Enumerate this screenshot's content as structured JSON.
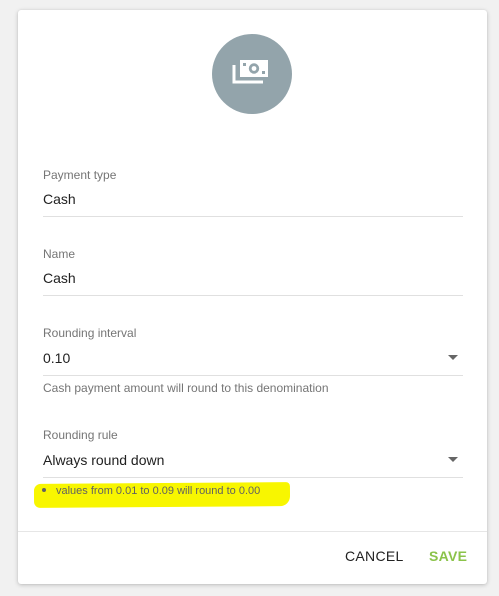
{
  "header": {
    "icon": "payment-cash-icon",
    "icon_bg": "#93a4ab"
  },
  "fields": {
    "payment_type": {
      "label": "Payment type",
      "value": "Cash"
    },
    "name": {
      "label": "Name",
      "value": "Cash"
    },
    "rounding_interval": {
      "label": "Rounding interval",
      "value": "0.10",
      "helper": "Cash payment amount will round to this denomination"
    },
    "rounding_rule": {
      "label": "Rounding rule",
      "value": "Always round down",
      "note": "values from 0.01 to 0.09 will round to 0.00"
    }
  },
  "actions": {
    "cancel_label": "CANCEL",
    "save_label": "SAVE",
    "save_color": "#8bc34a"
  },
  "annotation": {
    "highlight_color": "#f8f600"
  }
}
